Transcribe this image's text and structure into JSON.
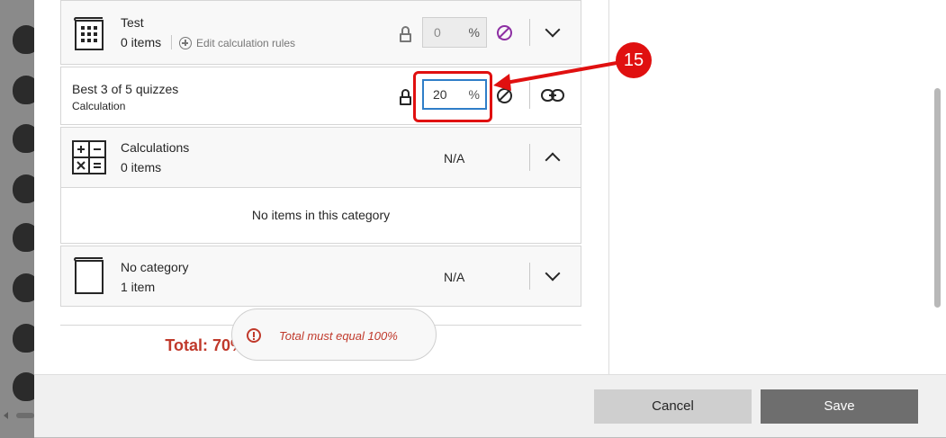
{
  "rows": {
    "test": {
      "title": "Test",
      "count": "0 items",
      "edit_rules": "Edit calculation rules",
      "value": "0",
      "unit": "%"
    },
    "best": {
      "title": "Best 3 of 5 quizzes",
      "type": "Calculation",
      "value": "20",
      "unit": "%"
    },
    "calculations": {
      "title": "Calculations",
      "count": "0 items",
      "value": "N/A",
      "empty_message": "No items in this category"
    },
    "nocategory": {
      "title": "No category",
      "count": "1 item",
      "value": "N/A"
    }
  },
  "toast": {
    "message": "Total must equal 100%"
  },
  "total": "Total: 70%",
  "footer": {
    "cancel_label": "Cancel",
    "save_label": "Save"
  },
  "annotation": {
    "step": "15"
  },
  "colors": {
    "accent": "#2f7ec8",
    "error": "#c0392b",
    "annotation": "#e01010",
    "ban": "#8d2fa3"
  }
}
